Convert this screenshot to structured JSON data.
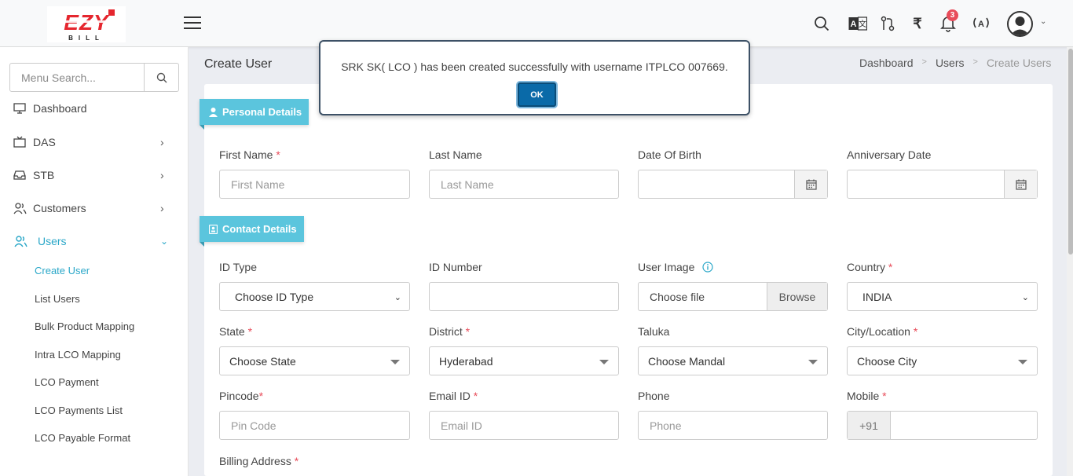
{
  "header": {
    "logo_text": "EZY BILL",
    "notification_count": "3",
    "icons": [
      "search-icon",
      "translate-icon",
      "compare-icon",
      "rupee-icon",
      "bell-icon",
      "broadcast-icon",
      "user-avatar-icon"
    ]
  },
  "sidebar": {
    "search_placeholder": "Menu Search...",
    "items": [
      {
        "label": "Dashboard",
        "icon": "monitor-icon"
      },
      {
        "label": "DAS",
        "icon": "tv-icon"
      },
      {
        "label": "STB",
        "icon": "inbox-icon"
      },
      {
        "label": "Customers",
        "icon": "customers-icon"
      },
      {
        "label": "Users",
        "icon": "users-icon"
      }
    ],
    "sub_items": [
      "Create User",
      "List Users",
      "Bulk Product Mapping",
      "Intra LCO Mapping",
      "LCO Payment",
      "LCO Payments List",
      "LCO Payable Format"
    ]
  },
  "page": {
    "title": "Create User",
    "breadcrumb": [
      "Dashboard",
      "Users",
      "Create Users"
    ]
  },
  "sections": {
    "personal": "Personal Details",
    "contact": "Contact Details"
  },
  "fields": {
    "first_name": {
      "label": "First Name",
      "placeholder": "First Name"
    },
    "last_name": {
      "label": "Last Name",
      "placeholder": "Last Name"
    },
    "dob": {
      "label": "Date Of Birth"
    },
    "anniversary": {
      "label": "Anniversary Date"
    },
    "id_type": {
      "label": "ID Type",
      "value": "Choose ID Type"
    },
    "id_number": {
      "label": "ID Number"
    },
    "user_image": {
      "label": "User Image",
      "value": "Choose file",
      "button": "Browse"
    },
    "country": {
      "label": "Country",
      "value": "INDIA"
    },
    "state": {
      "label": "State",
      "value": "Choose State"
    },
    "district": {
      "label": "District",
      "value": "Hyderabad"
    },
    "taluka": {
      "label": "Taluka",
      "value": "Choose Mandal"
    },
    "city": {
      "label": "City/Location",
      "value": "Choose City"
    },
    "pincode": {
      "label": "Pincode",
      "placeholder": "Pin Code"
    },
    "email": {
      "label": "Email ID",
      "placeholder": "Email ID"
    },
    "phone": {
      "label": "Phone",
      "placeholder": "Phone"
    },
    "mobile": {
      "label": "Mobile",
      "prefix": "+91"
    },
    "billing": {
      "label": "Billing Address"
    }
  },
  "required_mark": "*",
  "modal": {
    "message": "SRK SK( LCO ) has been created successfully with username ITPLCO 007669.",
    "ok_label": "OK"
  },
  "colors": {
    "accent": "#5bc5dd",
    "active_text": "#2aa7c8",
    "required": "#e84c5a",
    "ok_button": "#0a6aa8"
  }
}
